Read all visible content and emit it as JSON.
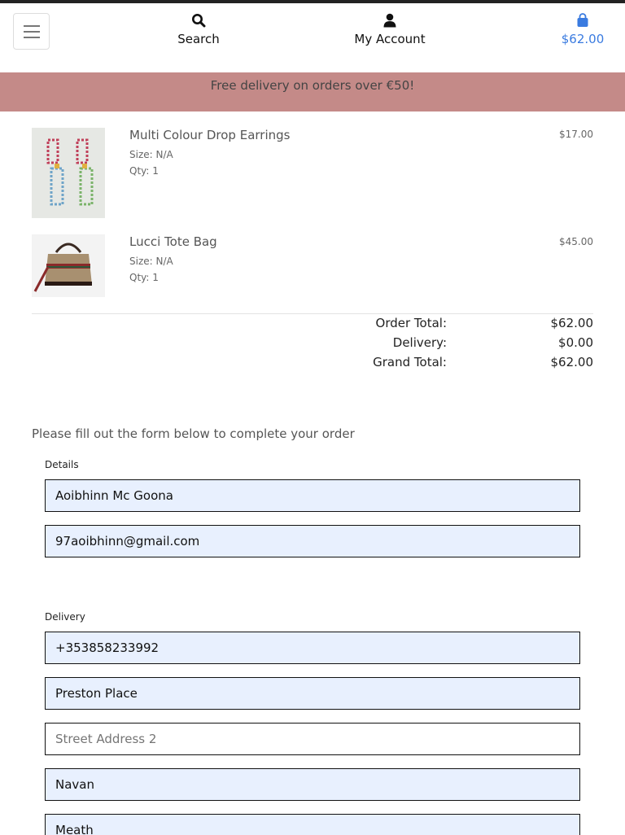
{
  "header": {
    "search_label": "Search",
    "account_label": "My Account",
    "bag_total": "$62.00",
    "accent_color": "#3a7be0"
  },
  "banner": {
    "text": "Free delivery on orders over €50!",
    "color": "#c48a88"
  },
  "cart": {
    "items": [
      {
        "name": "Multi Colour Drop Earrings",
        "size": "Size: N/A",
        "qty": "Qty: 1",
        "price": "$17.00"
      },
      {
        "name": "Lucci Tote Bag",
        "size": "Size: N/A",
        "qty": "Qty: 1",
        "price": "$45.00"
      }
    ]
  },
  "totals": {
    "order_label": "Order Total:",
    "order_value": "$62.00",
    "delivery_label": "Delivery:",
    "delivery_value": "$0.00",
    "grand_label": "Grand Total:",
    "grand_value": "$62.00"
  },
  "form": {
    "instruction": "Please fill out the form below to complete your order",
    "details_legend": "Details",
    "full_name": "Aoibhinn Mc Goona",
    "email": "97aoibhinn@gmail.com",
    "delivery_legend": "Delivery",
    "phone": "+353858233992",
    "street1": "Preston Place",
    "street2_placeholder": "Street Address 2",
    "town": "Navan",
    "county": "Meath"
  }
}
